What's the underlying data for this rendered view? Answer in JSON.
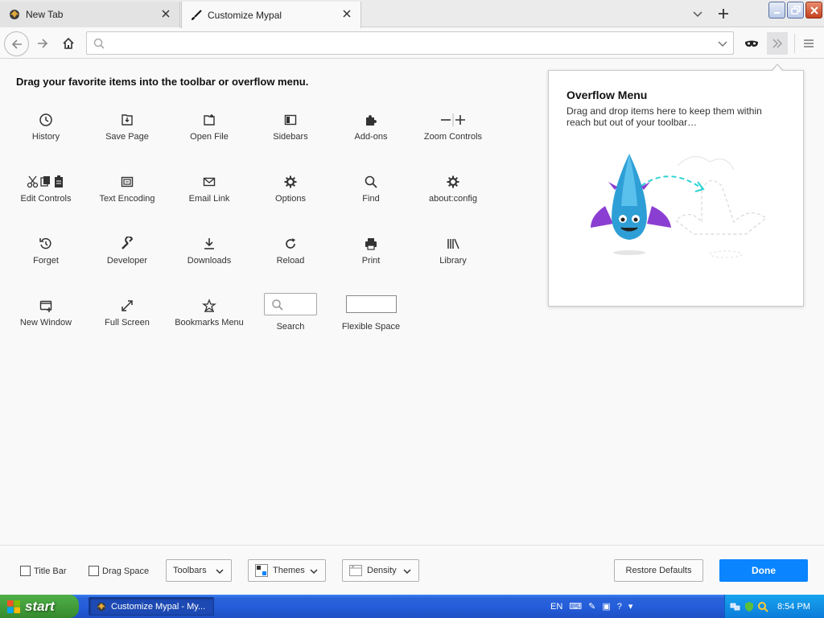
{
  "tabs": [
    {
      "label": "New Tab",
      "active": false
    },
    {
      "label": "Customize Mypal",
      "active": true
    }
  ],
  "urlbar": {
    "value": "",
    "placeholder": ""
  },
  "heading": "Drag your favorite items into the toolbar or overflow menu.",
  "palette": [
    {
      "label": "History",
      "icon": "history-icon"
    },
    {
      "label": "Save Page",
      "icon": "save-page-icon"
    },
    {
      "label": "Open File",
      "icon": "open-file-icon"
    },
    {
      "label": "Sidebars",
      "icon": "sidebars-icon"
    },
    {
      "label": "Add-ons",
      "icon": "addons-icon"
    },
    {
      "label": "Zoom Controls",
      "icon": "zoom-controls-icon"
    },
    {
      "label": "Edit Controls",
      "icon": "edit-controls-icon"
    },
    {
      "label": "Text Encoding",
      "icon": "text-encoding-icon"
    },
    {
      "label": "Email Link",
      "icon": "email-link-icon"
    },
    {
      "label": "Options",
      "icon": "gear-icon"
    },
    {
      "label": "Find",
      "icon": "find-icon"
    },
    {
      "label": "about:config",
      "icon": "gear-icon"
    },
    {
      "label": "Forget",
      "icon": "forget-icon"
    },
    {
      "label": "Developer",
      "icon": "wrench-icon"
    },
    {
      "label": "Downloads",
      "icon": "download-icon"
    },
    {
      "label": "Reload",
      "icon": "reload-icon"
    },
    {
      "label": "Print",
      "icon": "print-icon"
    },
    {
      "label": "Library",
      "icon": "library-icon"
    },
    {
      "label": "New Window",
      "icon": "new-window-icon"
    },
    {
      "label": "Full Screen",
      "icon": "full-screen-icon"
    },
    {
      "label": "Bookmarks Menu",
      "icon": "bookmarks-menu-icon"
    },
    {
      "label": "Search",
      "icon": "search-widget"
    },
    {
      "label": "Flexible Space",
      "icon": "flexible-space"
    }
  ],
  "overflow_panel": {
    "title": "Overflow Menu",
    "description": "Drag and drop items here to keep them within reach but out of your toolbar…"
  },
  "bottom": {
    "title_bar": "Title Bar",
    "drag_space": "Drag Space",
    "toolbars": "Toolbars",
    "themes": "Themes",
    "density": "Density",
    "restore": "Restore Defaults",
    "done": "Done"
  },
  "taskbar": {
    "start": "start",
    "task": "Customize Mypal - My...",
    "lang": "EN",
    "clock": "8:54 PM"
  },
  "colors": {
    "accent": "#0a84ff",
    "taskbar": "#245edb",
    "start": "#3c9a34"
  }
}
